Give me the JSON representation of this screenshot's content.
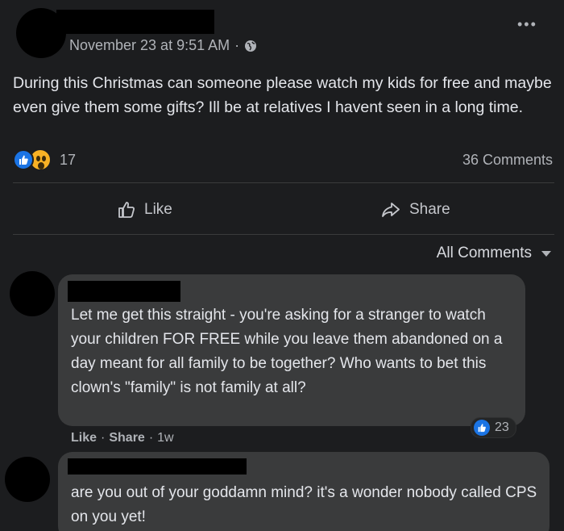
{
  "post": {
    "timestamp": "November 23 at 9:51 AM",
    "separator": "·",
    "more_icon": "•••",
    "body": "During this Christmas can someone please watch my kids for free and maybe even give them some gifts? Ill be at relatives I havent seen in a long time.",
    "reaction_count": "17",
    "comments_count": "36 Comments",
    "like_label": "Like",
    "share_label": "Share",
    "all_comments_label": "All Comments"
  },
  "comments": [
    {
      "text": "Let me get this straight - you're asking for a stranger to watch your children FOR FREE while you leave them abandoned on a day meant for all family to be together? Who wants to bet this clown's \"family\" is not family at all?",
      "like_label": "Like",
      "share_label": "Share",
      "separator": "·",
      "age": "1w",
      "reaction_count": "23"
    },
    {
      "text": "are you out of your goddamn mind? it's a wonder nobody called CPS on you yet!"
    }
  ],
  "colors": {
    "background": "#1c1d1f",
    "bubble": "#3a3b3c",
    "like_blue": "#1b74e4",
    "wow_yellow": "#f7b125"
  }
}
